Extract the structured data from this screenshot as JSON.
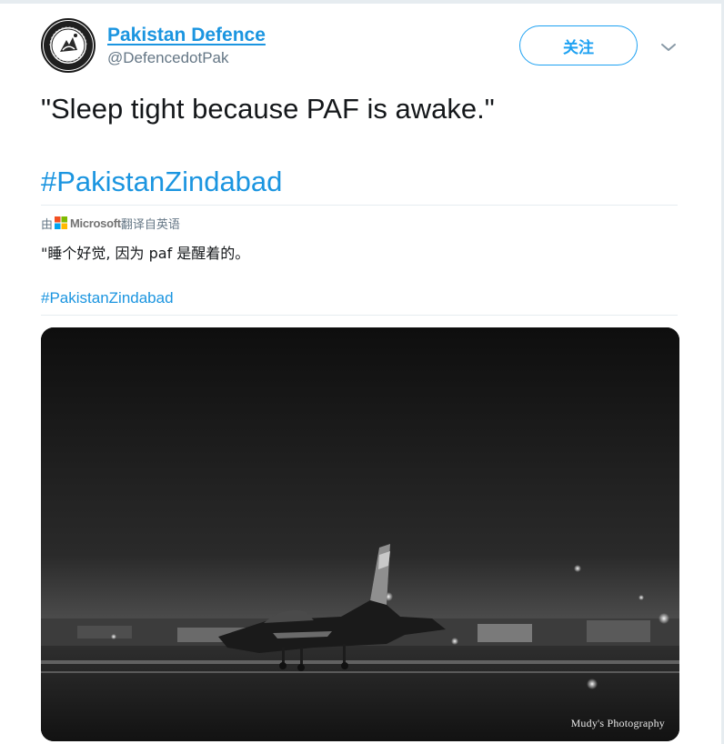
{
  "user": {
    "display_name": "Pakistan Defence",
    "handle": "@DefencedotPak",
    "avatar_icon": "pakistan-defence-emblem"
  },
  "actions": {
    "follow_label": "关注",
    "more_icon": "chevron-down-icon"
  },
  "tweet": {
    "text": "\"Sleep tight because PAF is awake.\"",
    "hashtag": "#PakistanZindabad"
  },
  "translation": {
    "prefix": "由",
    "provider": "Microsoft",
    "suffix": "翻译自英语",
    "text": "\"睡个好觉, 因为 paf 是醒着的。",
    "hashtag": "#PakistanZindabad"
  },
  "media": {
    "credit": "Mudy's Photography"
  },
  "colors": {
    "link_blue": "#1b95e0",
    "follow_border": "#1da1f2",
    "text_primary": "#14171a",
    "text_secondary": "#657786"
  }
}
